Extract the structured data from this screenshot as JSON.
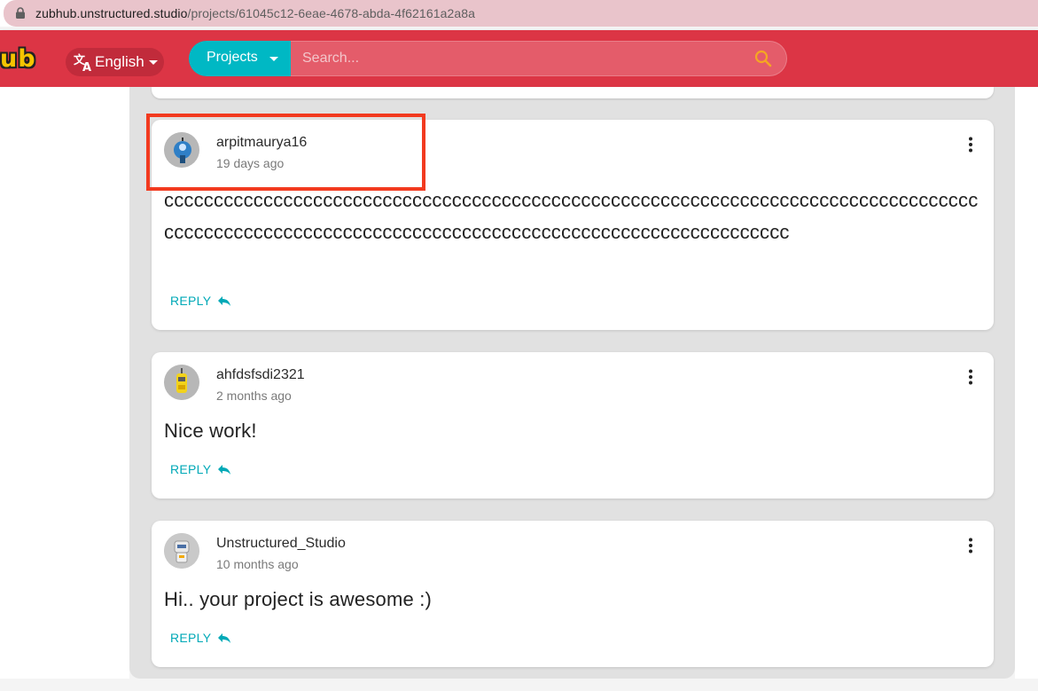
{
  "browser": {
    "url_host": "zubhub.unstructured.studio",
    "url_path": "/projects/61045c12-6eae-4678-abda-4f62161a2a8a"
  },
  "header": {
    "logo_text": "ub",
    "language_label": "English",
    "projects_label": "Projects",
    "search_placeholder": "Search..."
  },
  "colors": {
    "header_bg": "#dc3545",
    "accent_teal": "#00b8c4",
    "logo_yellow": "#f5c400",
    "highlight_border": "#f23a1f"
  },
  "comments": [
    {
      "username": "arpitmaurya16",
      "time_ago": "19 days ago",
      "text": "ccccccccccccccccccccccccccccccccccccccccccccccccccccccccccccccccccccccccccccccccccccccccccccccccccccccccccccccccccccccccccccccccccccccccccccccccc",
      "reply_label": "REPLY",
      "avatar_icon": "robot-avatar-icon",
      "highlighted": true
    },
    {
      "username": "ahfdsfsdi2321",
      "time_ago": "2 months ago",
      "text": "Nice work!",
      "reply_label": "REPLY",
      "avatar_icon": "robot-avatar-icon"
    },
    {
      "username": "Unstructured_Studio",
      "time_ago": "10 months ago",
      "text": "Hi.. your project is awesome :)",
      "reply_label": "REPLY",
      "avatar_icon": "robot-avatar-icon"
    }
  ]
}
